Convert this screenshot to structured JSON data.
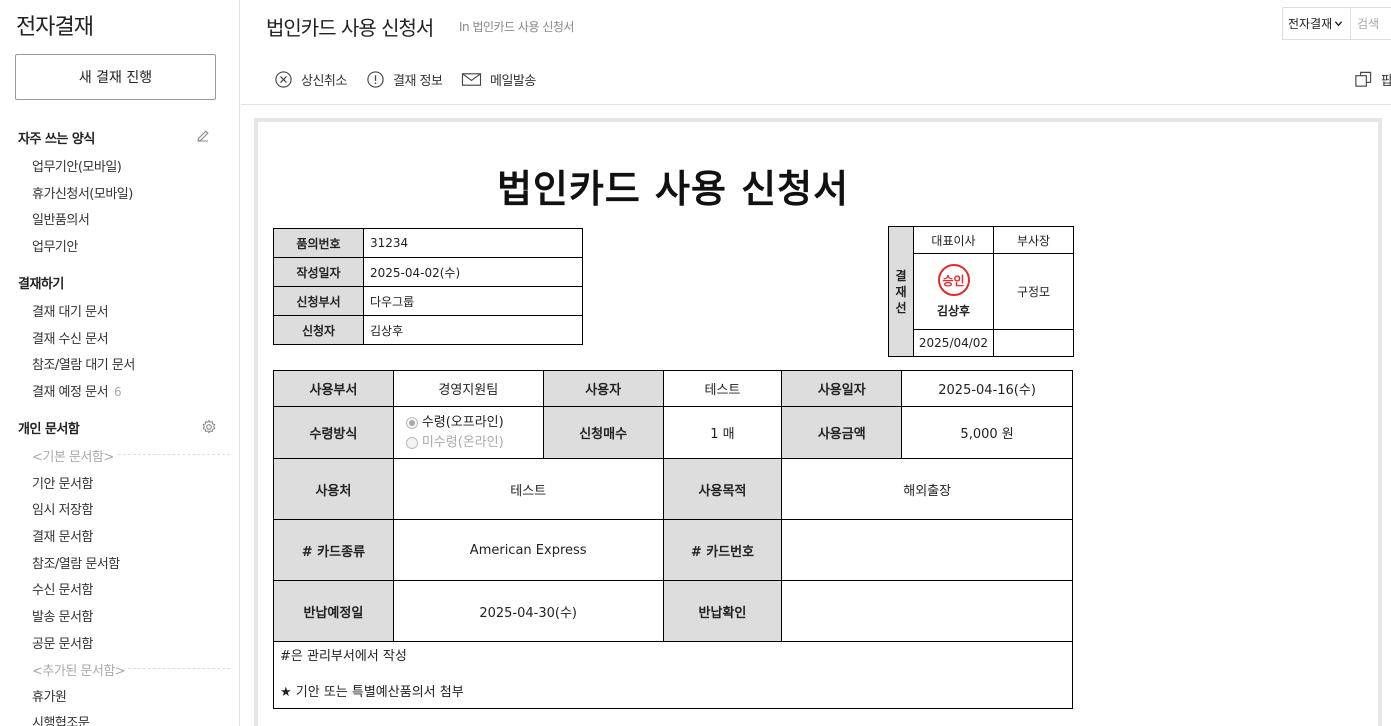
{
  "sidebar": {
    "app_title": "전자결재",
    "new_button": "새 결재 진행",
    "favorites": {
      "title": "자주 쓰는 양식",
      "items": [
        "업무기안(모바일)",
        "휴가신청서(모바일)",
        "일반품의서",
        "업무기안"
      ]
    },
    "approval": {
      "title": "결재하기",
      "items": [
        "결재 대기 문서",
        "결재 수신 문서",
        "참조/열람 대기 문서",
        "결재 예정 문서"
      ],
      "scheduled_count": "6"
    },
    "personal": {
      "title": "개인 문서함",
      "basic_label": "<기본 문서함>",
      "basic_items": [
        "기안 문서함",
        "임시 저장함",
        "결재 문서함",
        "참조/열람 문서함",
        "수신 문서함",
        "발송 문서함",
        "공문 문서함"
      ],
      "added_label": "<추가된 문서함>",
      "added_items": [
        "휴가원",
        "시행협조문"
      ]
    }
  },
  "header": {
    "title": "법인카드 사용 신청서",
    "path": "In 법인카드 사용 신청서",
    "search_select": "전자결재",
    "search_placeholder": "검색"
  },
  "toolbar": {
    "cancel": "상신취소",
    "info": "결재 정보",
    "mail": "메일발송",
    "popup": "팝"
  },
  "form": {
    "title": "법인카드 사용 신청서",
    "info": [
      {
        "label": "품의번호",
        "value": "31234"
      },
      {
        "label": "작성일자",
        "value": "2025-04-02(수)"
      },
      {
        "label": "신청부서",
        "value": "다우그룹"
      },
      {
        "label": "신청자",
        "value": "김상후"
      }
    ],
    "approval_line": {
      "side_label": [
        "결",
        "재",
        "선"
      ],
      "col1_title": "대표이사",
      "col2_title": "부사장",
      "stamp": "승인",
      "col1_name": "김상후",
      "col2_name": "구정모",
      "col1_date": "2025/04/02",
      "col2_date": ""
    },
    "rows": {
      "dept_label": "사용부서",
      "dept_value": "경영지원팀",
      "user_label": "사용자",
      "user_value": "테스트",
      "date_label": "사용일자",
      "date_value": "2025-04-16(수)",
      "receive_label": "수령방식",
      "receive_opt1": "수령(오프라인)",
      "receive_opt2": "미수령(온라인)",
      "count_label": "신청매수",
      "count_value": "1 매",
      "amount_label": "사용금액",
      "amount_value": "5,000 원",
      "place_label": "사용처",
      "place_value": "테스트",
      "purpose_label": "사용목적",
      "purpose_value": "해외출장",
      "card_type_label": "# 카드종류",
      "card_type_value": "American Express",
      "card_no_label": "# 카드번호",
      "card_no_value": "",
      "return_label": "반납예정일",
      "return_value": "2025-04-30(수)",
      "return_check_label": "반납확인",
      "return_check_value": "",
      "note1": "#은 관리부서에서 작성",
      "note2": "★ 기안 또는 특별예산품의서 첨부"
    }
  },
  "colors": {
    "label_bg": "#dddddd",
    "stamp_red": "#e02b2b",
    "border": "#000000"
  }
}
